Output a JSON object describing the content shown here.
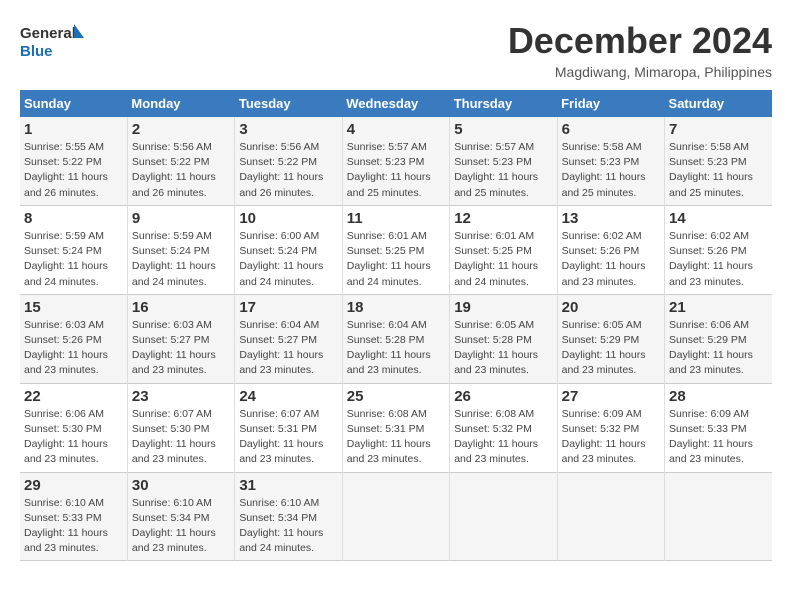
{
  "header": {
    "logo_line1": "General",
    "logo_line2": "Blue",
    "month_title": "December 2024",
    "location": "Magdiwang, Mimaropa, Philippines"
  },
  "weekdays": [
    "Sunday",
    "Monday",
    "Tuesday",
    "Wednesday",
    "Thursday",
    "Friday",
    "Saturday"
  ],
  "weeks": [
    [
      {
        "day": "1",
        "info": "Sunrise: 5:55 AM\nSunset: 5:22 PM\nDaylight: 11 hours\nand 26 minutes."
      },
      {
        "day": "2",
        "info": "Sunrise: 5:56 AM\nSunset: 5:22 PM\nDaylight: 11 hours\nand 26 minutes."
      },
      {
        "day": "3",
        "info": "Sunrise: 5:56 AM\nSunset: 5:22 PM\nDaylight: 11 hours\nand 26 minutes."
      },
      {
        "day": "4",
        "info": "Sunrise: 5:57 AM\nSunset: 5:23 PM\nDaylight: 11 hours\nand 25 minutes."
      },
      {
        "day": "5",
        "info": "Sunrise: 5:57 AM\nSunset: 5:23 PM\nDaylight: 11 hours\nand 25 minutes."
      },
      {
        "day": "6",
        "info": "Sunrise: 5:58 AM\nSunset: 5:23 PM\nDaylight: 11 hours\nand 25 minutes."
      },
      {
        "day": "7",
        "info": "Sunrise: 5:58 AM\nSunset: 5:23 PM\nDaylight: 11 hours\nand 25 minutes."
      }
    ],
    [
      {
        "day": "8",
        "info": "Sunrise: 5:59 AM\nSunset: 5:24 PM\nDaylight: 11 hours\nand 24 minutes."
      },
      {
        "day": "9",
        "info": "Sunrise: 5:59 AM\nSunset: 5:24 PM\nDaylight: 11 hours\nand 24 minutes."
      },
      {
        "day": "10",
        "info": "Sunrise: 6:00 AM\nSunset: 5:24 PM\nDaylight: 11 hours\nand 24 minutes."
      },
      {
        "day": "11",
        "info": "Sunrise: 6:01 AM\nSunset: 5:25 PM\nDaylight: 11 hours\nand 24 minutes."
      },
      {
        "day": "12",
        "info": "Sunrise: 6:01 AM\nSunset: 5:25 PM\nDaylight: 11 hours\nand 24 minutes."
      },
      {
        "day": "13",
        "info": "Sunrise: 6:02 AM\nSunset: 5:26 PM\nDaylight: 11 hours\nand 23 minutes."
      },
      {
        "day": "14",
        "info": "Sunrise: 6:02 AM\nSunset: 5:26 PM\nDaylight: 11 hours\nand 23 minutes."
      }
    ],
    [
      {
        "day": "15",
        "info": "Sunrise: 6:03 AM\nSunset: 5:26 PM\nDaylight: 11 hours\nand 23 minutes."
      },
      {
        "day": "16",
        "info": "Sunrise: 6:03 AM\nSunset: 5:27 PM\nDaylight: 11 hours\nand 23 minutes."
      },
      {
        "day": "17",
        "info": "Sunrise: 6:04 AM\nSunset: 5:27 PM\nDaylight: 11 hours\nand 23 minutes."
      },
      {
        "day": "18",
        "info": "Sunrise: 6:04 AM\nSunset: 5:28 PM\nDaylight: 11 hours\nand 23 minutes."
      },
      {
        "day": "19",
        "info": "Sunrise: 6:05 AM\nSunset: 5:28 PM\nDaylight: 11 hours\nand 23 minutes."
      },
      {
        "day": "20",
        "info": "Sunrise: 6:05 AM\nSunset: 5:29 PM\nDaylight: 11 hours\nand 23 minutes."
      },
      {
        "day": "21",
        "info": "Sunrise: 6:06 AM\nSunset: 5:29 PM\nDaylight: 11 hours\nand 23 minutes."
      }
    ],
    [
      {
        "day": "22",
        "info": "Sunrise: 6:06 AM\nSunset: 5:30 PM\nDaylight: 11 hours\nand 23 minutes."
      },
      {
        "day": "23",
        "info": "Sunrise: 6:07 AM\nSunset: 5:30 PM\nDaylight: 11 hours\nand 23 minutes."
      },
      {
        "day": "24",
        "info": "Sunrise: 6:07 AM\nSunset: 5:31 PM\nDaylight: 11 hours\nand 23 minutes."
      },
      {
        "day": "25",
        "info": "Sunrise: 6:08 AM\nSunset: 5:31 PM\nDaylight: 11 hours\nand 23 minutes."
      },
      {
        "day": "26",
        "info": "Sunrise: 6:08 AM\nSunset: 5:32 PM\nDaylight: 11 hours\nand 23 minutes."
      },
      {
        "day": "27",
        "info": "Sunrise: 6:09 AM\nSunset: 5:32 PM\nDaylight: 11 hours\nand 23 minutes."
      },
      {
        "day": "28",
        "info": "Sunrise: 6:09 AM\nSunset: 5:33 PM\nDaylight: 11 hours\nand 23 minutes."
      }
    ],
    [
      {
        "day": "29",
        "info": "Sunrise: 6:10 AM\nSunset: 5:33 PM\nDaylight: 11 hours\nand 23 minutes."
      },
      {
        "day": "30",
        "info": "Sunrise: 6:10 AM\nSunset: 5:34 PM\nDaylight: 11 hours\nand 23 minutes."
      },
      {
        "day": "31",
        "info": "Sunrise: 6:10 AM\nSunset: 5:34 PM\nDaylight: 11 hours\nand 24 minutes."
      },
      {
        "day": "",
        "info": ""
      },
      {
        "day": "",
        "info": ""
      },
      {
        "day": "",
        "info": ""
      },
      {
        "day": "",
        "info": ""
      }
    ]
  ]
}
